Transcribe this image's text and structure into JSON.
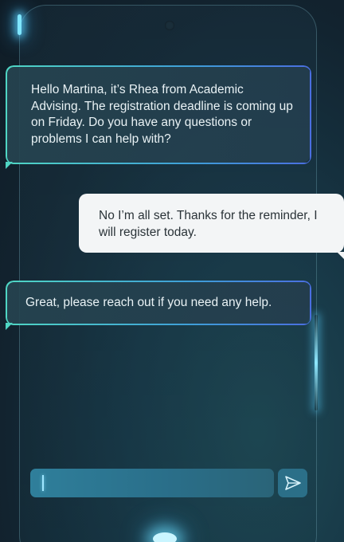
{
  "conversation": {
    "messages": [
      {
        "sender": "agent",
        "text": "Hello Martina, it’s Rhea from Academic Advising. The registration deadline is coming up on Friday. Do you have any questions or problems I can help with?"
      },
      {
        "sender": "user",
        "text": "No I’m all set. Thanks for the reminder, I will register today."
      },
      {
        "sender": "agent",
        "text": "Great, please reach out if you need any help."
      }
    ]
  },
  "composer": {
    "value": "",
    "placeholder": "",
    "send_icon": "send-icon"
  },
  "theme": {
    "agent_border_start": "#4fd6c4",
    "agent_border_end": "#4a6ee0",
    "user_bubble": "#f3f5f6",
    "accent_glow": "#7fe6ff"
  }
}
